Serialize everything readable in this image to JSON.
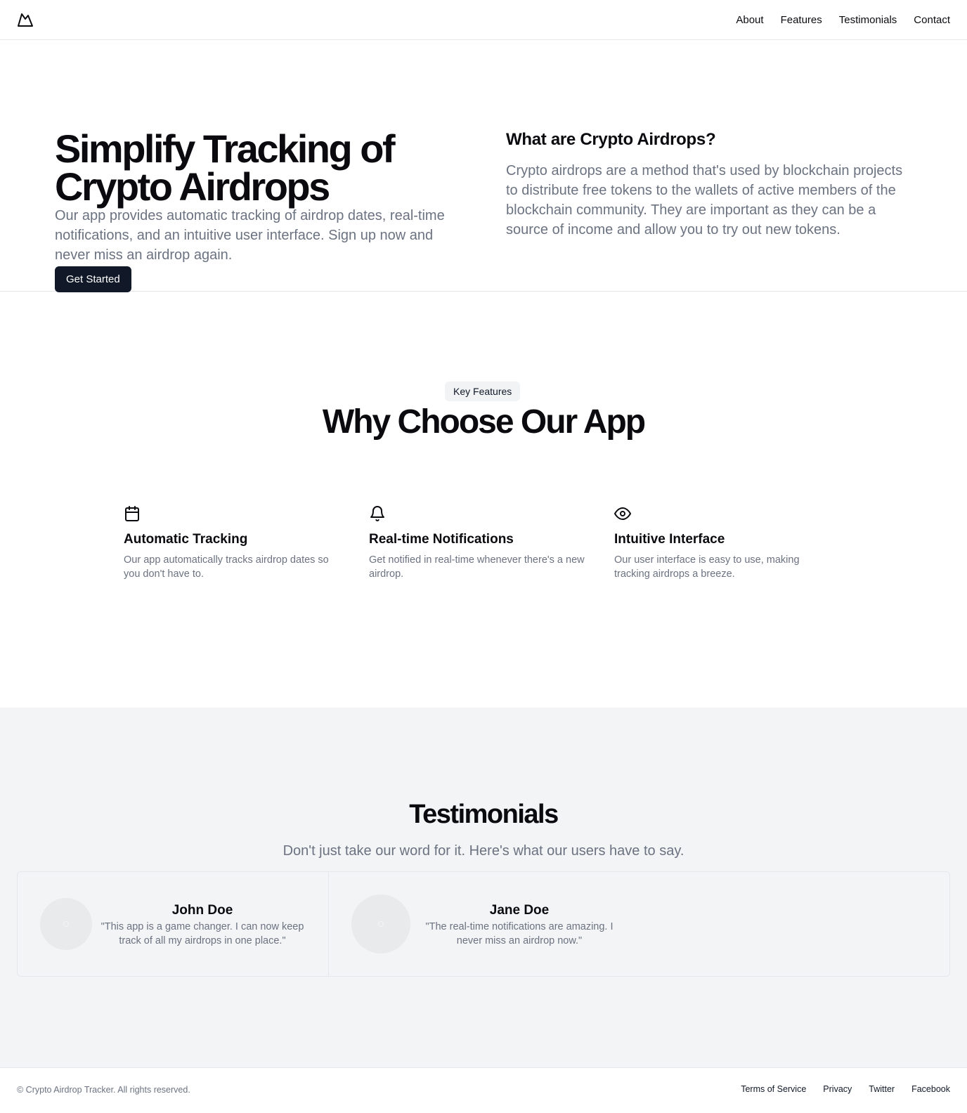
{
  "header": {
    "logo_icon": "mountain-logo-icon",
    "nav": [
      "About",
      "Features",
      "Testimonials",
      "Contact"
    ]
  },
  "hero": {
    "title_line1": "Simplify Tracking of",
    "title_line2": "Crypto Airdrops",
    "subtitle": "Our app provides automatic tracking of airdrop dates, real-time notifications, and an intuitive user interface. Sign up now and never miss an airdrop again.",
    "cta_label": "Get Started",
    "side_title": "What are Crypto Airdrops?",
    "side_text": "Crypto airdrops are a method that's used by blockchain projects to distribute free tokens to the wallets of active members of the blockchain community. They are important as they can be a source of income and allow you to try out new tokens."
  },
  "features": {
    "badge": "Key Features",
    "title": "Why Choose Our App",
    "items": [
      {
        "icon": "calendar-icon",
        "title": "Automatic Tracking",
        "text": "Our app automatically tracks airdrop dates so you don't have to."
      },
      {
        "icon": "bell-icon",
        "title": "Real-time Notifications",
        "text": "Get notified in real-time whenever there's a new airdrop."
      },
      {
        "icon": "eye-icon",
        "title": "Intuitive Interface",
        "text": "Our user interface is easy to use, making tracking airdrops a breeze."
      }
    ]
  },
  "testimonials": {
    "title": "Testimonials",
    "subtitle": "Don't just take our word for it. Here's what our users have to say.",
    "items": [
      {
        "name": "John Doe",
        "quote": "\"This app is a game changer. I can now keep track of all my airdrops in one place.\""
      },
      {
        "name": "Jane Doe",
        "quote": "\"The real-time notifications are amazing. I never miss an airdrop now.\""
      }
    ]
  },
  "footer": {
    "copyright": "© Crypto Airdrop Tracker. All rights reserved.",
    "links": [
      "Terms of Service",
      "Privacy",
      "Twitter",
      "Facebook"
    ]
  },
  "colors": {
    "primary_button": "#111827",
    "muted_text": "#6b7280",
    "testimonials_bg": "#f3f4f6",
    "badge_bg": "#f1f3f5"
  }
}
